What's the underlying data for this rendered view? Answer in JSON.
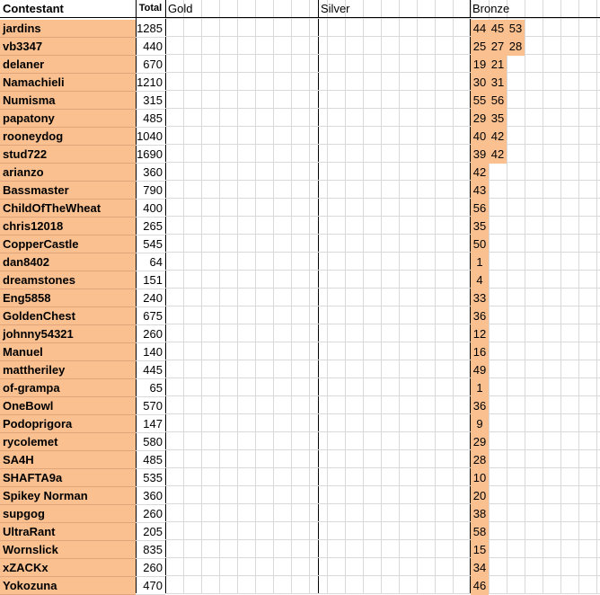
{
  "header": {
    "contestant": "Contestant",
    "total": "Total",
    "gold": "Gold",
    "silver": "Silver",
    "bronze": "Bronze"
  },
  "rows": [
    {
      "name": "jardins",
      "total": "1285",
      "bronze": [
        "44",
        "45",
        "53"
      ]
    },
    {
      "name": "vb3347",
      "total": "440",
      "bronze": [
        "25",
        "27",
        "28"
      ]
    },
    {
      "name": "delaner",
      "total": "670",
      "bronze": [
        "19",
        "21"
      ]
    },
    {
      "name": "Namachieli",
      "total": "1210",
      "bronze": [
        "30",
        "31"
      ]
    },
    {
      "name": "Numisma",
      "total": "315",
      "bronze": [
        "55",
        "56"
      ]
    },
    {
      "name": "papatony",
      "total": "485",
      "bronze": [
        "29",
        "35"
      ]
    },
    {
      "name": "rooneydog",
      "total": "1040",
      "bronze": [
        "40",
        "42"
      ]
    },
    {
      "name": "stud722",
      "total": "1690",
      "bronze": [
        "39",
        "42"
      ]
    },
    {
      "name": "arianzo",
      "total": "360",
      "bronze": [
        "42"
      ]
    },
    {
      "name": "Bassmaster",
      "total": "790",
      "bronze": [
        "43"
      ]
    },
    {
      "name": "ChildOfTheWheat",
      "total": "400",
      "bronze": [
        "56"
      ]
    },
    {
      "name": "chris12018",
      "total": "265",
      "bronze": [
        "35"
      ]
    },
    {
      "name": "CopperCastle",
      "total": "545",
      "bronze": [
        "50"
      ]
    },
    {
      "name": "dan8402",
      "total": "64",
      "bronze": [
        "1"
      ]
    },
    {
      "name": "dreamstones",
      "total": "151",
      "bronze": [
        "4"
      ]
    },
    {
      "name": "Eng5858",
      "total": "240",
      "bronze": [
        "33"
      ]
    },
    {
      "name": "GoldenChest",
      "total": "675",
      "bronze": [
        "36"
      ]
    },
    {
      "name": "johnny54321",
      "total": "260",
      "bronze": [
        "12"
      ]
    },
    {
      "name": "Manuel",
      "total": "140",
      "bronze": [
        "16"
      ]
    },
    {
      "name": "mattheriley",
      "total": "445",
      "bronze": [
        "49"
      ]
    },
    {
      "name": "of-grampa",
      "total": "65",
      "bronze": [
        "1"
      ]
    },
    {
      "name": "OneBowl",
      "total": "570",
      "bronze": [
        "36"
      ]
    },
    {
      "name": "Podoprigora",
      "total": "147",
      "bronze": [
        "9"
      ]
    },
    {
      "name": "rycolemet",
      "total": "580",
      "bronze": [
        "29"
      ]
    },
    {
      "name": "SA4H",
      "total": "485",
      "bronze": [
        "28"
      ]
    },
    {
      "name": "SHAFTA9a",
      "total": "535",
      "bronze": [
        "10"
      ]
    },
    {
      "name": "Spikey Norman",
      "total": "360",
      "bronze": [
        "20"
      ]
    },
    {
      "name": "supgog",
      "total": "260",
      "bronze": [
        "38"
      ]
    },
    {
      "name": "UltraRant",
      "total": "205",
      "bronze": [
        "58"
      ]
    },
    {
      "name": "Wornslick",
      "total": "835",
      "bronze": [
        "15"
      ]
    },
    {
      "name": "xZACKx",
      "total": "260",
      "bronze": [
        "34"
      ]
    },
    {
      "name": "Yokozuna",
      "total": "470",
      "bronze": [
        "46"
      ]
    }
  ],
  "colors": {
    "name_fill": "#fac090",
    "medal_fill": "#fac090",
    "grid": "#d9d9d9",
    "border": "#000000"
  }
}
